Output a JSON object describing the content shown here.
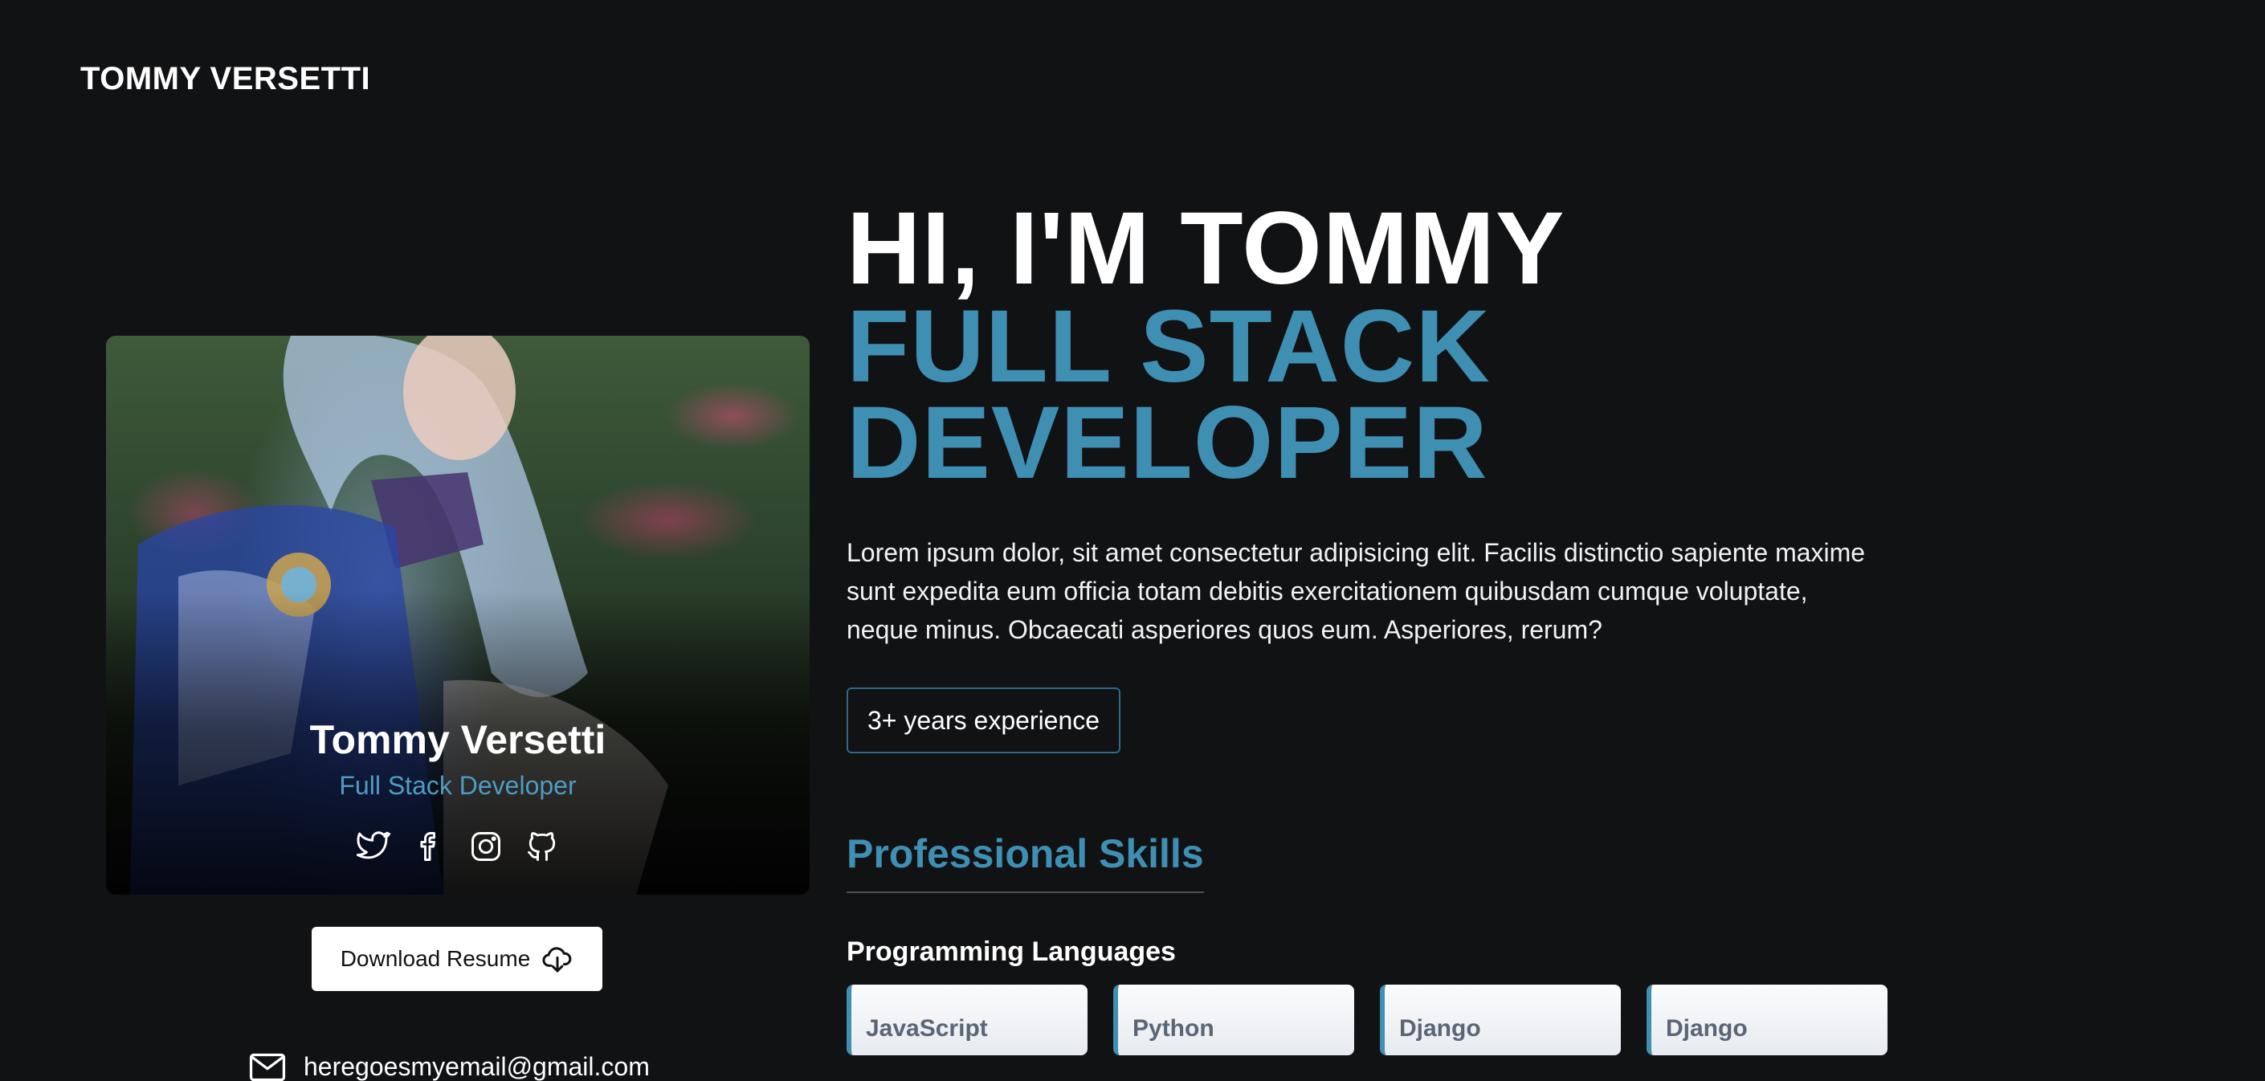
{
  "header": {
    "brand": "TOMMY VERSETTI"
  },
  "profile_card": {
    "name": "Tommy Versetti",
    "role": "Full Stack Developer",
    "socials": [
      "twitter-icon",
      "facebook-icon",
      "instagram-icon",
      "github-icon"
    ]
  },
  "download_button": {
    "label": "Download Resume",
    "icon": "cloud-download-icon"
  },
  "contact": {
    "email": "heregoesmyemail@gmail.com",
    "icon": "mail-icon"
  },
  "hero": {
    "greeting": "HI, I'M TOMMY",
    "title": "FULL STACK DEVELOPER",
    "intro": "Lorem ipsum dolor, sit amet consectetur adipisicing elit. Facilis distinctio sapiente maxime sunt expedita eum officia totam debitis exercitationem quibusdam cumque voluptate, neque minus. Obcaecati asperiores quos eum. Asperiores, rerum?",
    "experience_badge": "3+ years experience"
  },
  "skills": {
    "section_title": "Professional Skills",
    "groups": [
      {
        "title": "Programming Languages",
        "items": [
          "JavaScript",
          "Python",
          "Django",
          "Django"
        ]
      }
    ]
  },
  "colors": {
    "accent": "#3f8fb3",
    "background": "#111214",
    "text": "#ffffff"
  }
}
